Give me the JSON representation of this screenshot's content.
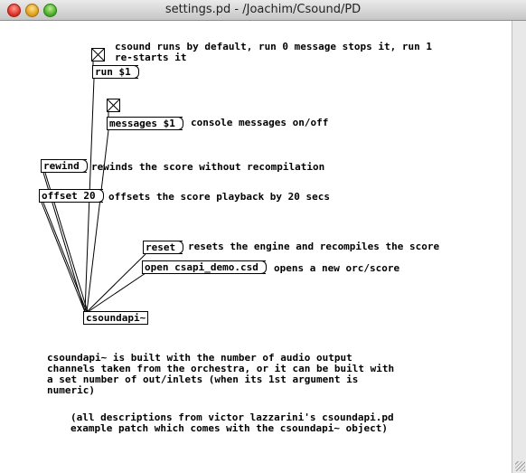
{
  "window": {
    "title": "settings.pd  - /Joachim/Csound/PD"
  },
  "patch": {
    "comments": {
      "run_comment": "csound runs by default, run 0 message stops it, run 1\nre-starts it",
      "messages_comment": "console messages on/off",
      "rewind_comment": "rewinds the score without recompilation",
      "offset_comment": "offsets the score playback by 20 secs",
      "reset_comment": "resets the engine and recompiles the score",
      "open_comment": "opens a new orc/score",
      "info_comment": "csoundapi~ is built with the number of audio output\nchannels taken from the orchestra, or it can be built with\na set number of out/inlets (when its 1st argument is\nnumeric)",
      "credit_comment": "(all descriptions from victor lazzarini's csoundapi.pd\nexample patch which comes with the csoundapi~ object)"
    },
    "messages": {
      "run": "run $1",
      "messages": "messages $1",
      "rewind": "rewind",
      "offset": "offset 20",
      "reset": "reset",
      "open": "open csapi_demo.csd"
    },
    "objects": {
      "csoundapi": "csoundapi~"
    }
  }
}
